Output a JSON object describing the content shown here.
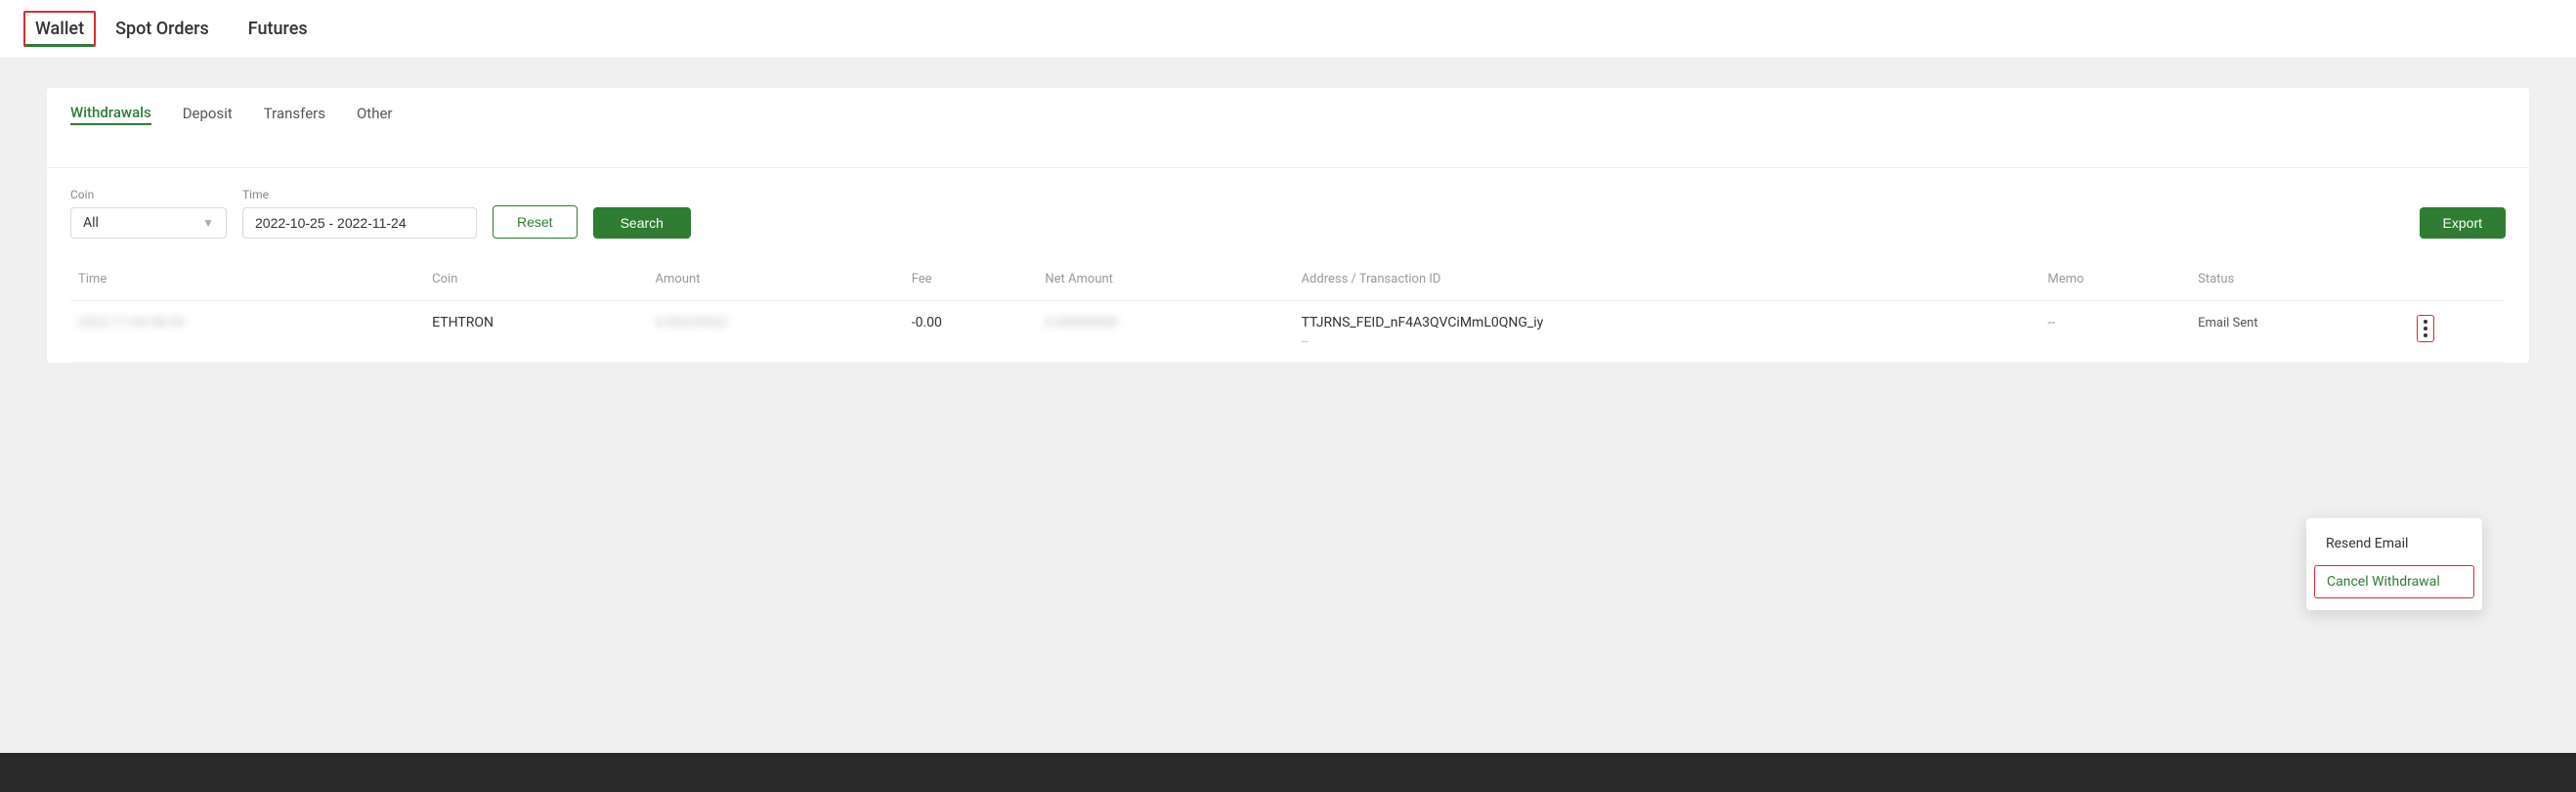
{
  "nav": {
    "tabs": [
      {
        "id": "wallet",
        "label": "Wallet",
        "active": true
      },
      {
        "id": "spot-orders",
        "label": "Spot Orders",
        "active": false
      },
      {
        "id": "futures",
        "label": "Futures",
        "active": false
      }
    ]
  },
  "sub_tabs": [
    {
      "id": "withdrawals",
      "label": "Withdrawals",
      "active": true
    },
    {
      "id": "deposit",
      "label": "Deposit",
      "active": false
    },
    {
      "id": "transfers",
      "label": "Transfers",
      "active": false
    },
    {
      "id": "other",
      "label": "Other",
      "active": false
    }
  ],
  "filters": {
    "coin_label": "Coin",
    "coin_value": "All",
    "time_label": "Time",
    "time_value": "2022-10-25 - 2022-11-24",
    "reset_label": "Reset",
    "search_label": "Search",
    "export_label": "Export"
  },
  "table": {
    "columns": [
      {
        "id": "time",
        "label": "Time"
      },
      {
        "id": "coin",
        "label": "Coin"
      },
      {
        "id": "amount",
        "label": "Amount"
      },
      {
        "id": "fee",
        "label": "Fee"
      },
      {
        "id": "net_amount",
        "label": "Net Amount"
      },
      {
        "id": "address",
        "label": "Address / Transaction ID"
      },
      {
        "id": "memo",
        "label": "Memo"
      },
      {
        "id": "status",
        "label": "Status"
      }
    ],
    "rows": [
      {
        "time": "2022-11-04 08:39",
        "coin": "ETHTRON",
        "amount": "0.00235422",
        "fee": "-0.00",
        "net_amount": "0.00000000",
        "address": "TTJRNS_FEID_nF4A3QVCiMmL0QNG_iy",
        "address_sub": "--",
        "memo": "--",
        "status": "Email Sent"
      }
    ]
  },
  "dropdown": {
    "items": [
      {
        "id": "resend-email",
        "label": "Resend Email",
        "cancel": false
      },
      {
        "id": "cancel-withdrawal",
        "label": "Cancel Withdrawal",
        "cancel": true
      }
    ]
  }
}
